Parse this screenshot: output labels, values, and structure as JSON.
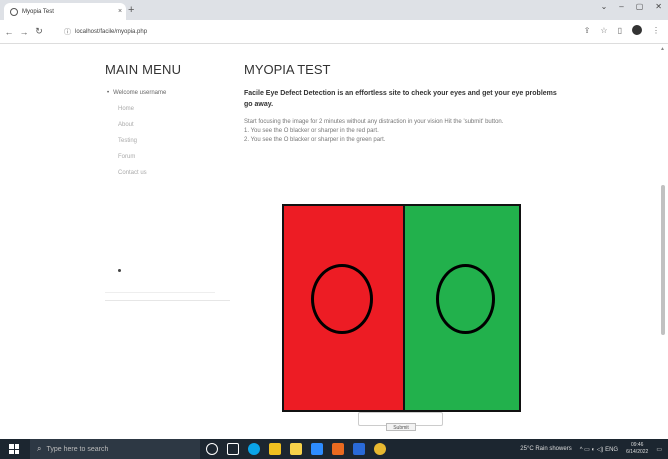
{
  "browser": {
    "tab_title": "Myopia Test",
    "tab_close": "×",
    "new_tab": "+",
    "window_controls": [
      "⌄",
      "–",
      "▢",
      "✕"
    ],
    "nav": {
      "back": "←",
      "forward": "→",
      "reload": "↻"
    },
    "url": "localhost/facile/myopia.php",
    "lock_icon": "ⓘ",
    "right_icons": [
      "⇪",
      "☆",
      "▯",
      "⋮"
    ]
  },
  "sidebar": {
    "title": "MAIN MENU",
    "items": [
      {
        "label": "Welcome username",
        "bullet": "•"
      },
      {
        "label": "Home"
      },
      {
        "label": "About"
      },
      {
        "label": "Testing"
      },
      {
        "label": "Forum"
      },
      {
        "label": "Contact us"
      }
    ]
  },
  "main": {
    "title": "MYOPIA TEST",
    "lead": "Facile Eye Defect Detection is an effortless site to check your eyes and get your eye problems go away.",
    "instructions": [
      "Start focusing the image for 2 minutes without any distraction in your vision Hit the 'submit' button.",
      "1. You see the O blacker or sharper in the red part.",
      "2. You see the O blacker or sharper in the green part."
    ],
    "test_colors": {
      "left": "#ed1c24",
      "right": "#22b14c"
    },
    "submit_label": "Submit"
  },
  "taskbar": {
    "search_placeholder": "Type here to search",
    "search_icon": "⌕",
    "app_colors": [
      "#ffffff",
      "#ffffff",
      "#0aa4e8",
      "#f0c020",
      "#f7d24a",
      "#2d8cff",
      "#ea6a20",
      "#2a6ad8",
      "#e8b830"
    ],
    "weather": "25°C  Rain showers",
    "tray_icons": "^  ▭  ◐  ◁)  ENG",
    "time": "09:46",
    "date": "6/14/2022"
  }
}
